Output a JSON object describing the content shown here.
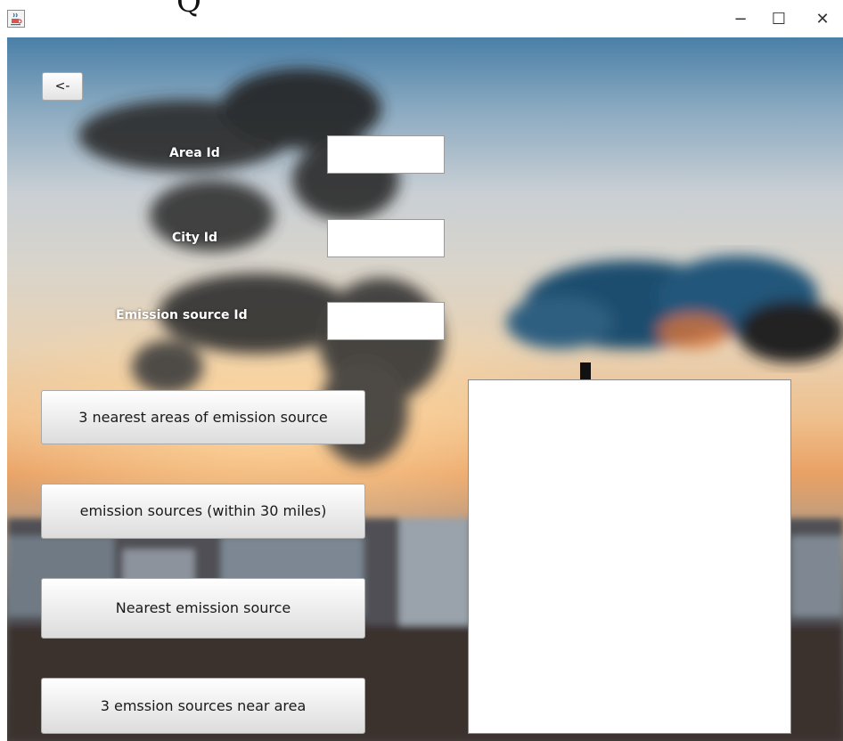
{
  "window": {
    "minimize_glyph": "−",
    "maximize_glyph": "☐",
    "close_glyph": "✕",
    "app_icon": "java-cup-icon",
    "title_fragment": "Q"
  },
  "form": {
    "back_label": "<-",
    "area_id_label": "Area Id",
    "area_id_value": "",
    "city_id_label": "City Id",
    "city_id_value": "",
    "emission_source_id_label": "Emission source Id",
    "emission_source_id_value": ""
  },
  "actions": {
    "nearest_areas_label": "3 nearest areas of emission source",
    "within_30_miles_label": "emission sources (within 30 miles)",
    "nearest_source_label": "Nearest emission source",
    "near_area_label": "3 emssion sources near area"
  },
  "results": {
    "text": ""
  },
  "colors": {
    "button_gradient_top": "#ffffff",
    "button_gradient_bottom": "#dcdcdc",
    "label_color": "#ffffff"
  }
}
